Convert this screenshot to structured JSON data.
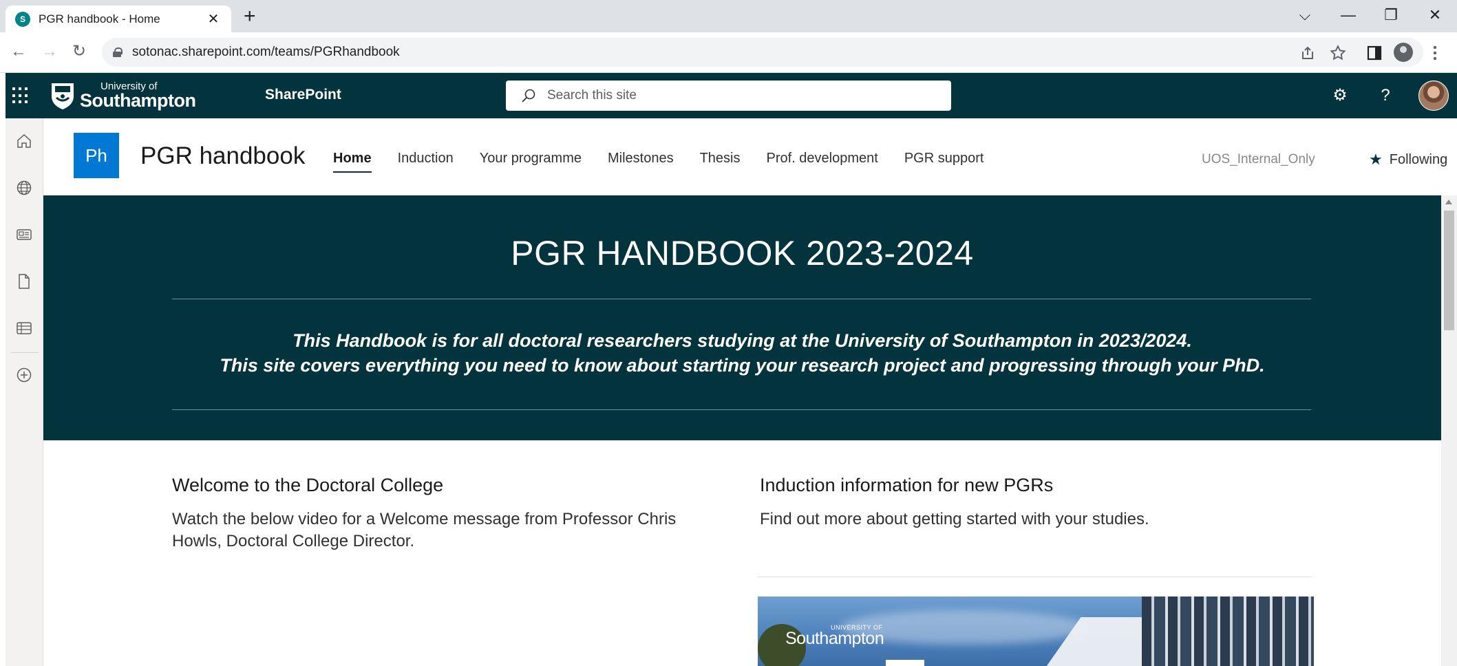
{
  "browser": {
    "tab_title": "PGR handbook - Home",
    "tab_favicon_letter": "S",
    "close_glyph": "✕",
    "new_tab_glyph": "+",
    "url": "sotonac.sharepoint.com/teams/PGRhandbook",
    "back_glyph": "←",
    "forward_glyph": "→",
    "reload_glyph": "↻",
    "window_controls": {
      "dropdown": "⌵",
      "minimize": "—",
      "restore": "❐",
      "close": "✕"
    },
    "icons": [
      "share-icon",
      "star-icon",
      "side-panel-icon",
      "profile-icon",
      "kebab-menu-icon"
    ]
  },
  "suitebar": {
    "logo_small": "University of",
    "logo_big": "Southampton",
    "app_name": "SharePoint",
    "search_placeholder": "Search this site",
    "settings_glyph": "⚙",
    "help_glyph": "?",
    "background_color": "#03333d"
  },
  "appbar": {
    "icons": [
      "home-icon",
      "globe-icon",
      "news-icon",
      "file-icon",
      "list-icon",
      "create-icon"
    ]
  },
  "site": {
    "logo_text": "Ph",
    "title": "PGR handbook",
    "nav": [
      {
        "label": "Home",
        "active": true
      },
      {
        "label": "Induction"
      },
      {
        "label": "Your programme"
      },
      {
        "label": "Milestones"
      },
      {
        "label": "Thesis"
      },
      {
        "label": "Prof. development"
      },
      {
        "label": "PGR support"
      }
    ],
    "classification": "UOS_Internal_Only",
    "follow_label": "Following",
    "accent_color": "#0078d4"
  },
  "hero": {
    "title": "PGR HANDBOOK 2023-2024",
    "line1": "This Handbook is for all doctoral researchers studying at the University of Southampton in 2023/2024.",
    "line2": "This site covers everything you need to know about starting your research project and progressing through your PhD."
  },
  "sections": {
    "welcome": {
      "heading": "Welcome to the Doctoral College",
      "text_line1": "Watch the below video for a Welcome message from Professor Chris",
      "text_line2": "Howls, Doctoral College Director."
    },
    "induction": {
      "heading": "Induction information for new PGRs",
      "text": "Find out more about getting started with your studies.",
      "image_logo_small": "UNIVERSITY OF",
      "image_logo_big": "Southampton"
    }
  }
}
